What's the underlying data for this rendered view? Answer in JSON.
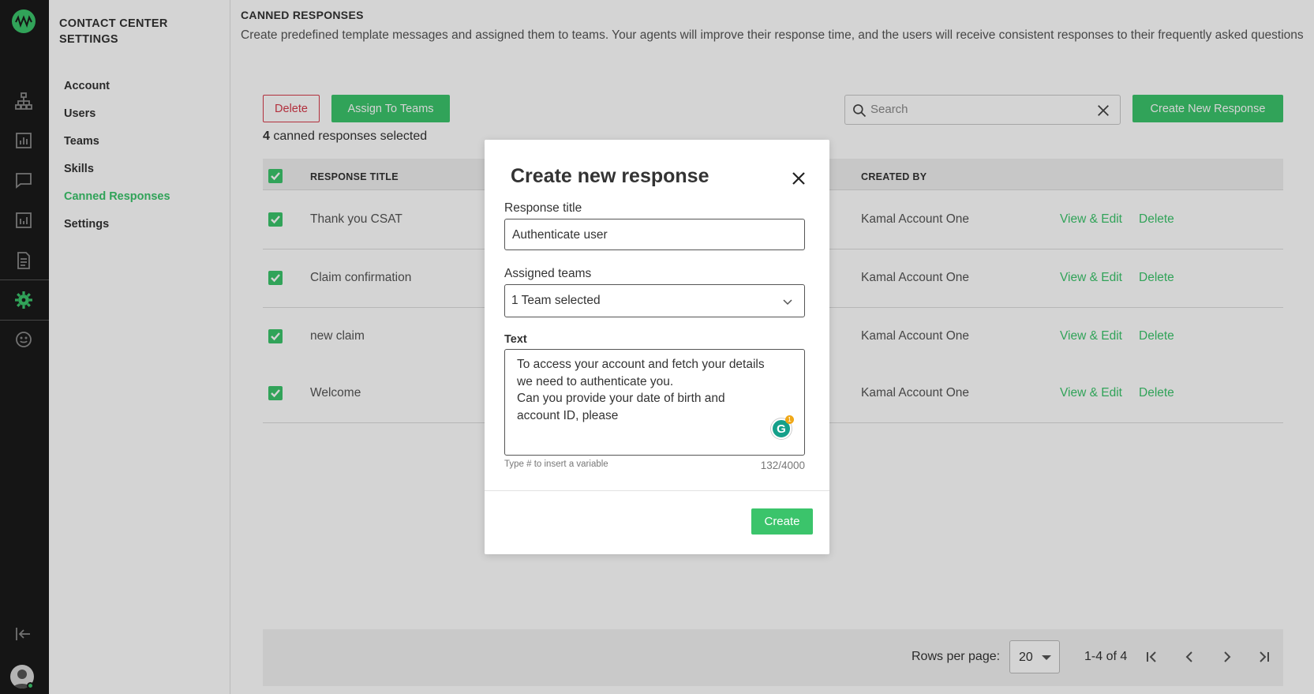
{
  "sidebar": {
    "title": "CONTACT CENTER SETTINGS",
    "items": [
      {
        "label": "Account"
      },
      {
        "label": "Users"
      },
      {
        "label": "Teams"
      },
      {
        "label": "Skills"
      },
      {
        "label": "Canned Responses"
      },
      {
        "label": "Settings"
      }
    ],
    "active_item": "Canned Responses"
  },
  "rail": {
    "icons": [
      "logo-icon",
      "org-chart-icon",
      "reports-icon",
      "chat-icon",
      "analytics-icon",
      "document-icon",
      "gear-icon",
      "smiley-icon",
      "logout-icon",
      "user-avatar-icon"
    ],
    "active_icon": "gear-icon"
  },
  "page": {
    "title": "CANNED RESPONSES",
    "description": "Create predefined template messages and assigned them to teams. Your agents will improve their response time, and the users will receive consistent responses to their frequently asked questions"
  },
  "toolbar": {
    "delete_label": "Delete",
    "assign_label": "Assign To Teams",
    "selected_count": "4",
    "selected_suffix": "canned responses selected",
    "search_placeholder": "Search",
    "create_label": "Create New Response"
  },
  "table": {
    "headers": {
      "title": "RESPONSE TITLE",
      "created_by": "CREATED BY"
    },
    "rows": [
      {
        "title": "Thank you CSAT",
        "created_by": "Kamal Account One",
        "edit": "View & Edit",
        "delete": "Delete",
        "checked": true
      },
      {
        "title": "Claim confirmation",
        "created_by": "Kamal Account One",
        "edit": "View & Edit",
        "delete": "Delete",
        "checked": true
      },
      {
        "title": "new claim",
        "created_by": "Kamal Account One",
        "edit": "View & Edit",
        "delete": "Delete",
        "checked": true
      },
      {
        "title": "Welcome",
        "created_by": "Kamal Account One",
        "edit": "View & Edit",
        "delete": "Delete",
        "checked": true
      }
    ]
  },
  "pagination": {
    "rows_label": "Rows per page:",
    "rows_value": "20",
    "range": "1-4 of 4"
  },
  "modal": {
    "title": "Create new response",
    "title_label": "Response title",
    "title_value": "Authenticate user",
    "teams_label": "Assigned teams",
    "teams_value": "1 Team selected",
    "text_label": "Text",
    "text_value": "To access your account and fetch your details\nwe need to authenticate you.\nCan you provide your date of birth and\naccount ID, please",
    "hint": "Type # to insert a variable",
    "char_count": "132/4000",
    "grammarly_count": "1",
    "create_label": "Create"
  },
  "colors": {
    "accent": "#3bc46b",
    "danger": "#d63a4a",
    "rail_bg": "#1a1a1a"
  }
}
